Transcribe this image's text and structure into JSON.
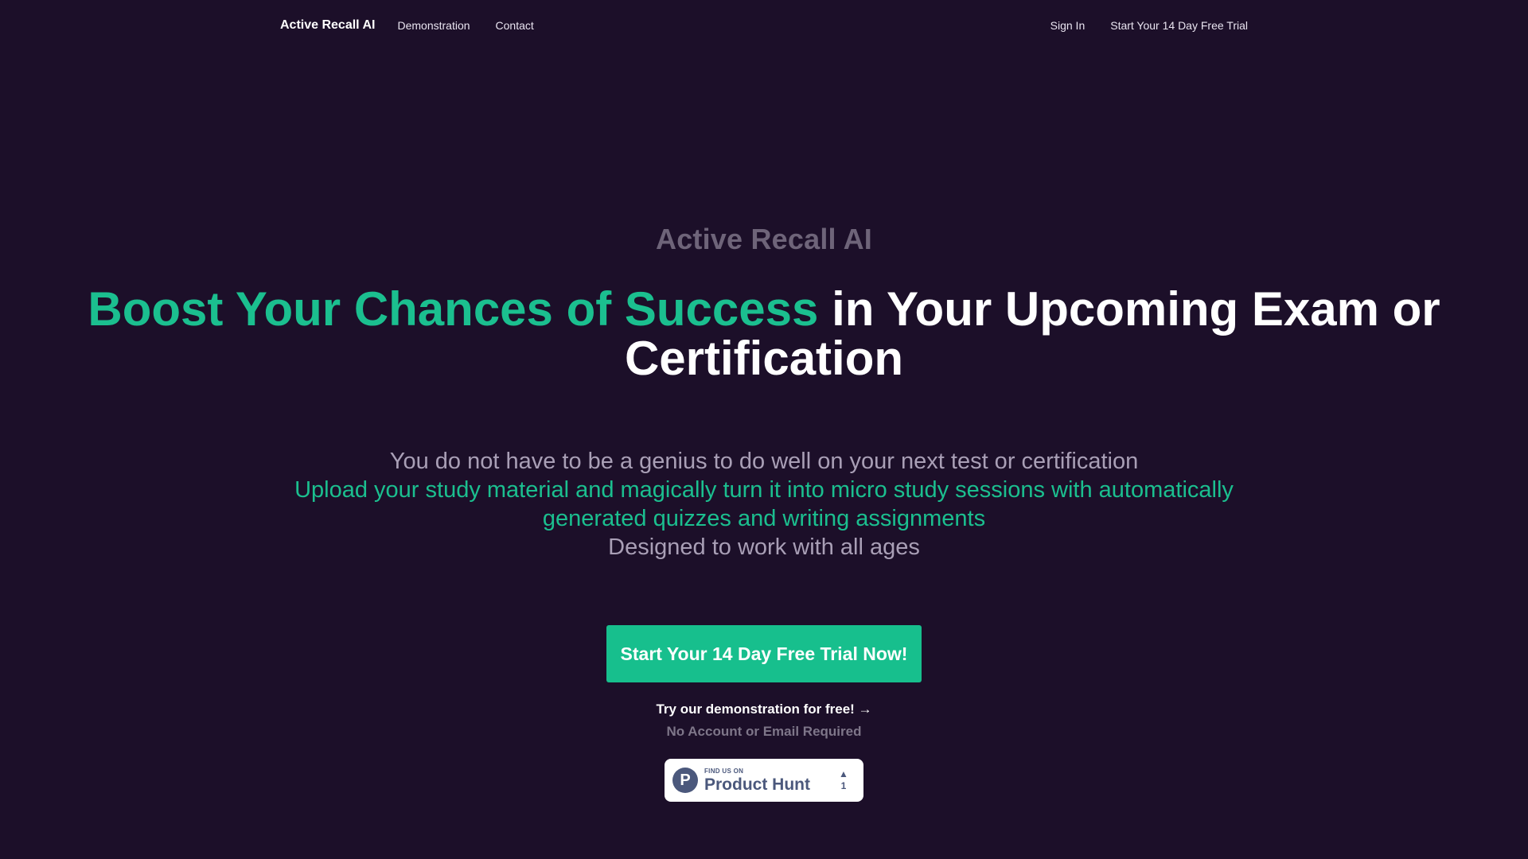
{
  "nav": {
    "brand": "Active Recall AI",
    "links": [
      "Demonstration",
      "Contact"
    ],
    "sign_in": "Sign In",
    "trial": "Start Your 14 Day Free Trial"
  },
  "hero": {
    "eyebrow": "Active Recall AI",
    "headline_accent": "Boost Your Chances of Success",
    "headline_rest": " in Your Upcoming Exam or Certification",
    "line1": "You do not have to be a genius to do well on your next test or certification",
    "line2": "Upload your study material and magically turn it into micro study sessions with automatically generated quizzes and writing assignments",
    "line3": "Designed to work with all ages",
    "cta": "Start Your 14 Day Free Trial Now!",
    "demo_link": "Try our demonstration for free! →",
    "note": "No Account or Email Required"
  },
  "product_hunt": {
    "logo_letter": "P",
    "find": "FIND US ON",
    "name": "Product Hunt",
    "arrow": "▲",
    "count": "1"
  },
  "colors": {
    "background": "#1c0f29",
    "accent": "#17bf8d",
    "muted": "#6e6479"
  }
}
